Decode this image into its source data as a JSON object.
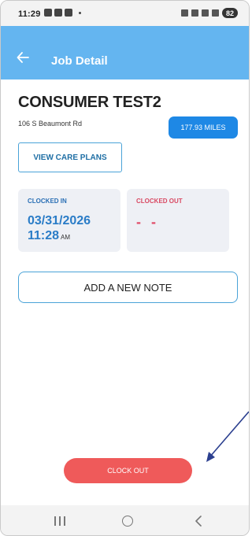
{
  "status_bar": {
    "time": "11:29",
    "battery": "82"
  },
  "app_bar": {
    "title": "Job Detail",
    "back_icon": "arrow-left-icon"
  },
  "job": {
    "consumer_name": "CONSUMER TEST2",
    "address": "106 S Beaumont Rd",
    "distance": "177.93 MILES"
  },
  "buttons": {
    "view_care_plans": "VIEW CARE PLANS",
    "add_note": "ADD A NEW NOTE",
    "clock_out": "CLOCK OUT"
  },
  "clocked_in": {
    "label": "CLOCKED IN",
    "date": "03/31/2026",
    "time": "11:28",
    "ampm": "AM"
  },
  "clocked_out": {
    "label": "CLOCKED OUT",
    "value": "- -"
  },
  "colors": {
    "app_bar": "#64b5f0",
    "accent_blue": "#1e88e5",
    "clock_out_red": "#ef5a5a",
    "clocked_out_label": "#d94a63"
  }
}
